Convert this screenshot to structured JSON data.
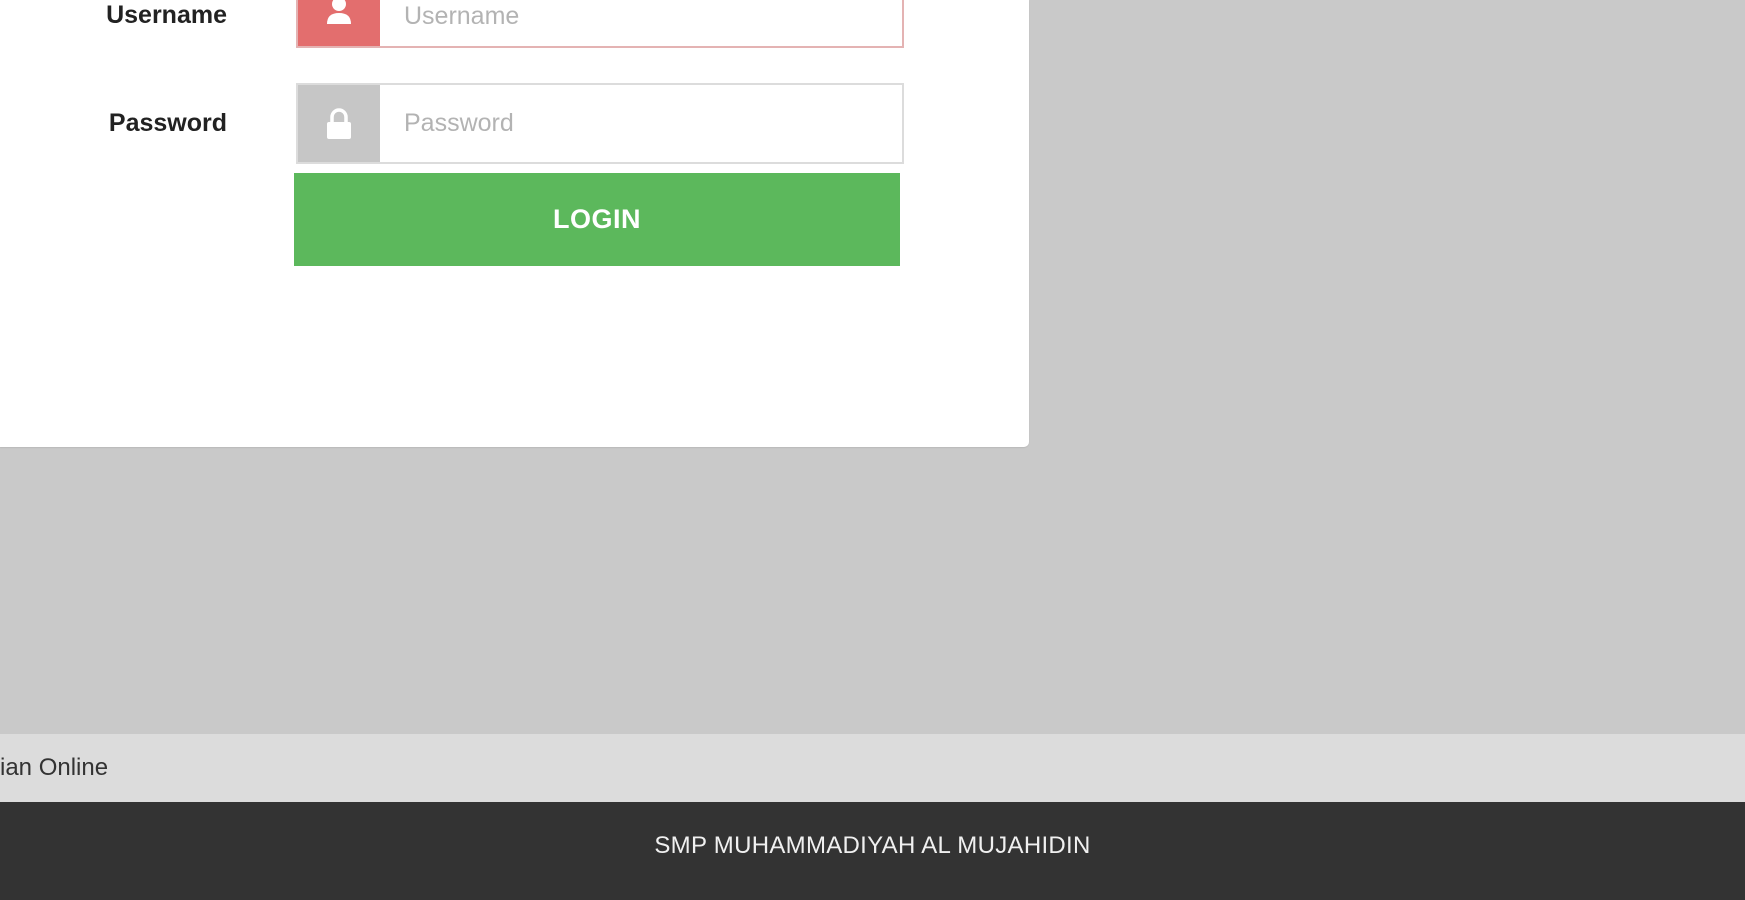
{
  "login_form": {
    "username": {
      "label": "Username",
      "placeholder": "Username",
      "value": "",
      "icon": "user-icon"
    },
    "password": {
      "label": "Password",
      "placeholder": "Password",
      "value": "",
      "icon": "lock-icon"
    },
    "login_label": "LOGIN"
  },
  "subfooter": {
    "text": "ian Online"
  },
  "footer": {
    "text": "SMP MUHAMMADIYAH AL MUJAHIDIN"
  },
  "colors": {
    "page_background": "#c9c9c9",
    "card_background": "#ffffff",
    "username_addon": "#e36e6e",
    "password_addon": "#c6c6c6",
    "login_button": "#5cb85c",
    "subfooter_background": "#dcdcdc",
    "footer_background": "#333333"
  }
}
